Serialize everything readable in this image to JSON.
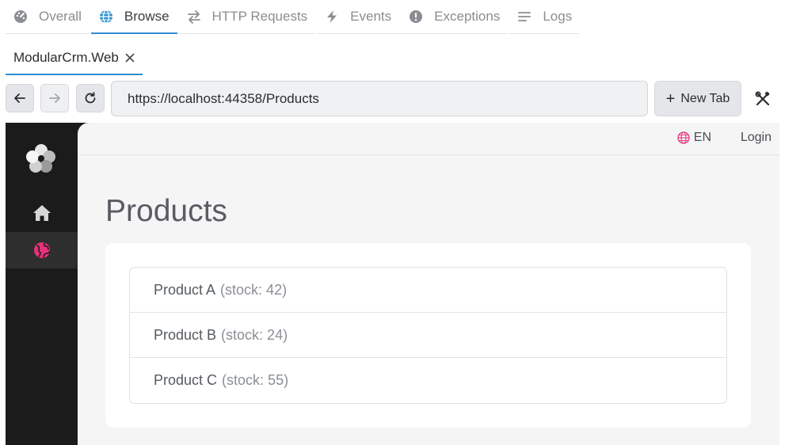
{
  "topnav": {
    "tabs": [
      {
        "label": "Overall",
        "icon": "dashboard-icon",
        "active": false
      },
      {
        "label": "Browse",
        "icon": "globe-icon",
        "active": true
      },
      {
        "label": "HTTP Requests",
        "icon": "arrows-exchange-icon",
        "active": false
      },
      {
        "label": "Events",
        "icon": "lightning-icon",
        "active": false
      },
      {
        "label": "Exceptions",
        "icon": "exclamation-circle-icon",
        "active": false
      },
      {
        "label": "Logs",
        "icon": "lines-icon",
        "active": false
      }
    ]
  },
  "app_tabs": [
    {
      "label": "ModularCrm.Web",
      "close_icon": "close-icon"
    }
  ],
  "toolbar": {
    "url": "https://localhost:44358/Products",
    "new_tab_label": "New Tab",
    "back_icon": "arrow-left-icon",
    "forward_icon": "arrow-right-icon",
    "reload_icon": "reload-icon",
    "tools_icon": "tools-icon"
  },
  "app": {
    "header": {
      "language": "EN",
      "login": "Login"
    },
    "page_title": "Products",
    "products": [
      {
        "name": "Product A",
        "stock": "(stock: 42)"
      },
      {
        "name": "Product B",
        "stock": "(stock: 24)"
      },
      {
        "name": "Product C",
        "stock": "(stock: 55)"
      }
    ]
  },
  "colors": {
    "accent_blue": "#2d8fd1",
    "accent_pink": "#e8317a",
    "sidebar_bg": "#1b1b1b",
    "content_bg": "#f5f5f6"
  }
}
